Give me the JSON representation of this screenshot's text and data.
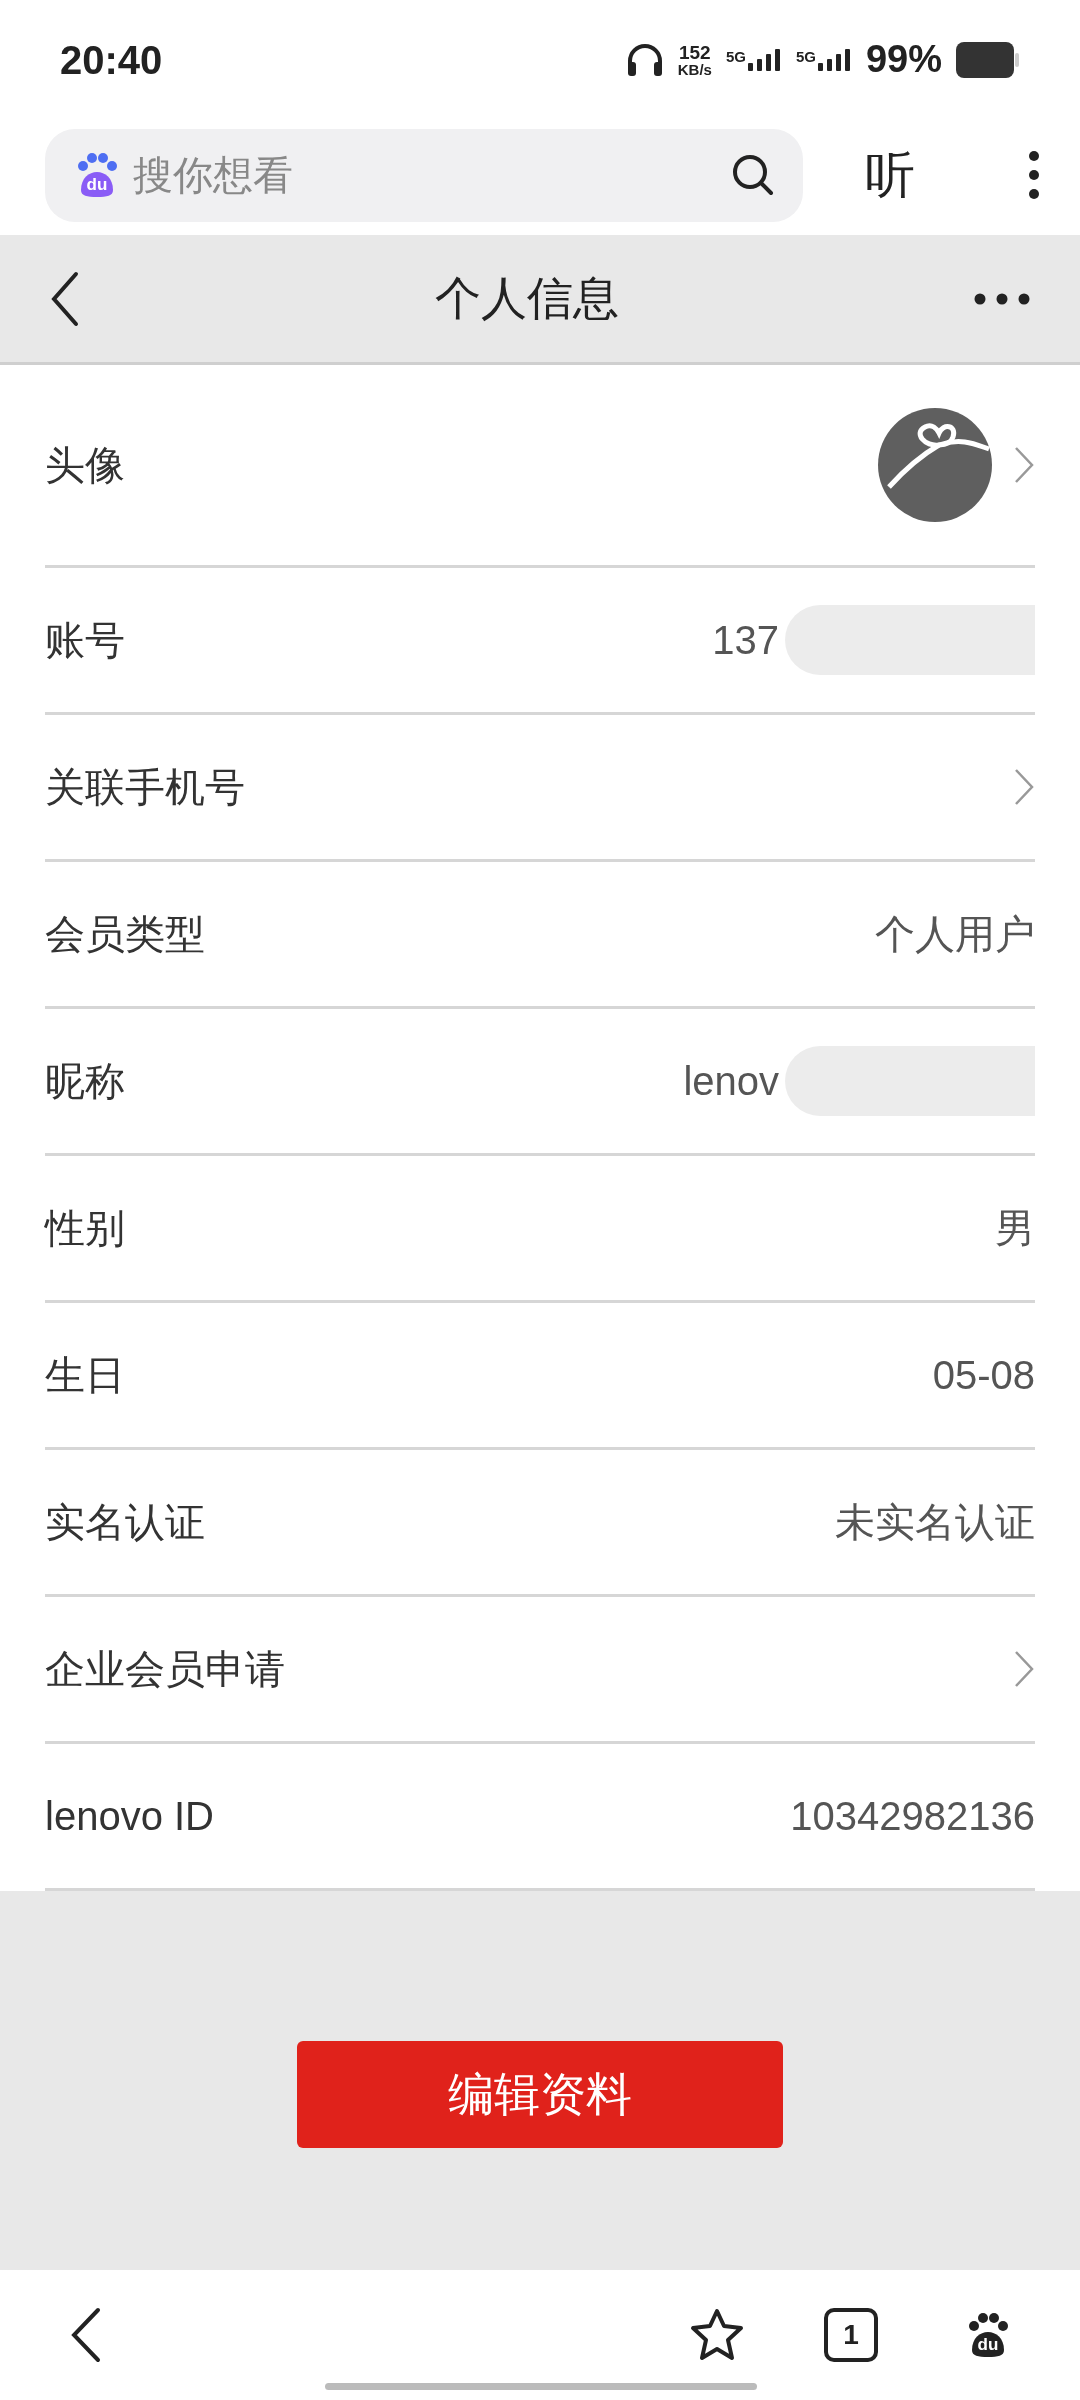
{
  "status_bar": {
    "time": "20:40",
    "speed": "152",
    "speed_unit": "KB/s",
    "networks": [
      "5G",
      "5G"
    ],
    "battery": "99%"
  },
  "search": {
    "logo_text": "du",
    "placeholder": "搜你想看",
    "listen": "听"
  },
  "header": {
    "title": "个人信息"
  },
  "rows": [
    {
      "label": "头像",
      "chevron": true
    },
    {
      "kind": "value",
      "label": "账号",
      "value": "137",
      "redacted": true,
      "chevron": false
    },
    {
      "kind": "value",
      "label": "关联手机号",
      "chevron": true
    },
    {
      "kind": "value",
      "label": "会员类型",
      "value": "个人用户",
      "chevron": false
    },
    {
      "kind": "value",
      "label": "昵称",
      "value": "lenov",
      "redacted": true,
      "chevron": false
    },
    {
      "kind": "value",
      "label": "性别",
      "value": "男",
      "chevron": false
    },
    {
      "kind": "value",
      "label": "生日",
      "value": "05-08",
      "chevron": false
    },
    {
      "kind": "value",
      "label": "实名认证",
      "value": "未实名认证",
      "chevron": false
    },
    {
      "kind": "value",
      "label": "企业会员申请",
      "chevron": true
    },
    {
      "kind": "value",
      "label": "lenovo ID",
      "value": "10342982136",
      "chevron": false
    }
  ],
  "edit_button": "编辑资料",
  "bottom_bar": {
    "tab_count": "1",
    "logo_text": "du"
  }
}
